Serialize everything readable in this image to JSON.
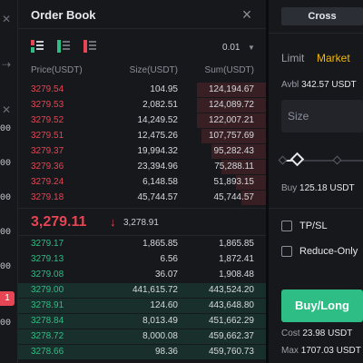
{
  "left_strip": {
    "items": [
      {
        "icon": "close-icon"
      },
      {
        "icon": "arrow-icon"
      },
      {
        "icon": "close-icon"
      },
      {
        "value": "00"
      },
      {
        "value": "00"
      },
      {
        "value": "00"
      },
      {
        "value": "00"
      },
      {
        "value": "00"
      },
      {
        "value": "00"
      }
    ],
    "badge": "1"
  },
  "order_book": {
    "title": "Order Book",
    "precision": "0.01",
    "headers": {
      "price": "Price(USDT)",
      "size": "Size(USDT)",
      "sum": "Sum(USDT)"
    },
    "asks": [
      {
        "price": "3279.54",
        "size": "104.95",
        "sum": "124,194.67",
        "depth": 0.28
      },
      {
        "price": "3279.53",
        "size": "2,082.51",
        "sum": "124,089.72",
        "depth": 0.28
      },
      {
        "price": "3279.52",
        "size": "14,249.52",
        "sum": "122,007.21",
        "depth": 0.28
      },
      {
        "price": "3279.51",
        "size": "12,475.26",
        "sum": "107,757.69",
        "depth": 0.26
      },
      {
        "price": "3279.37",
        "size": "19,994.32",
        "sum": "95,282.43",
        "depth": 0.22
      },
      {
        "price": "3279.36",
        "size": "23,394.96",
        "sum": "75,288.11",
        "depth": 0.18
      },
      {
        "price": "3279.24",
        "size": "6,148.58",
        "sum": "51,893.15",
        "depth": 0.12
      },
      {
        "price": "3279.18",
        "size": "45,744.57",
        "sum": "45,744.57",
        "depth": 0.1
      }
    ],
    "mid": {
      "price": "3,279.11",
      "mark": "3,278.91"
    },
    "bids": [
      {
        "price": "3279.17",
        "size": "1,865.85",
        "sum": "1,865.85",
        "depth": 0.0
      },
      {
        "price": "3279.13",
        "size": "6.56",
        "sum": "1,872.41",
        "depth": 0.0
      },
      {
        "price": "3279.08",
        "size": "36.07",
        "sum": "1,908.48",
        "depth": 0.0
      },
      {
        "price": "3279.00",
        "size": "441,615.72",
        "sum": "443,524.20",
        "depth": 1.0
      },
      {
        "price": "3278.91",
        "size": "124.60",
        "sum": "443,648.80",
        "depth": 1.0
      },
      {
        "price": "3278.84",
        "size": "8,013.49",
        "sum": "451,662.29",
        "depth": 1.0
      },
      {
        "price": "3278.72",
        "size": "8,000.08",
        "sum": "459,662.37",
        "depth": 1.0
      },
      {
        "price": "3278.66",
        "size": "98.36",
        "sum": "459,760.73",
        "depth": 1.0
      }
    ]
  },
  "trade": {
    "margin_mode": "Cross",
    "tabs": {
      "limit": "Limit",
      "market": "Market"
    },
    "avbl_label": "Avbl",
    "avbl_value": "342.57 USDT",
    "size_placeholder": "Size",
    "buy_label": "Buy",
    "buy_value": "125.18 USDT",
    "tpsl_label": "TP/SL",
    "reduce_only_label": "Reduce-Only",
    "buy_long_label": "Buy/Long",
    "cost_label": "Cost",
    "cost_value": "23.98 USDT",
    "max_label": "Max",
    "max_value": "1707.03 USDT"
  },
  "colors": {
    "ask": "#e64553",
    "bid": "#2ebd85",
    "accent": "#f0b90b",
    "background": "#17181c"
  }
}
